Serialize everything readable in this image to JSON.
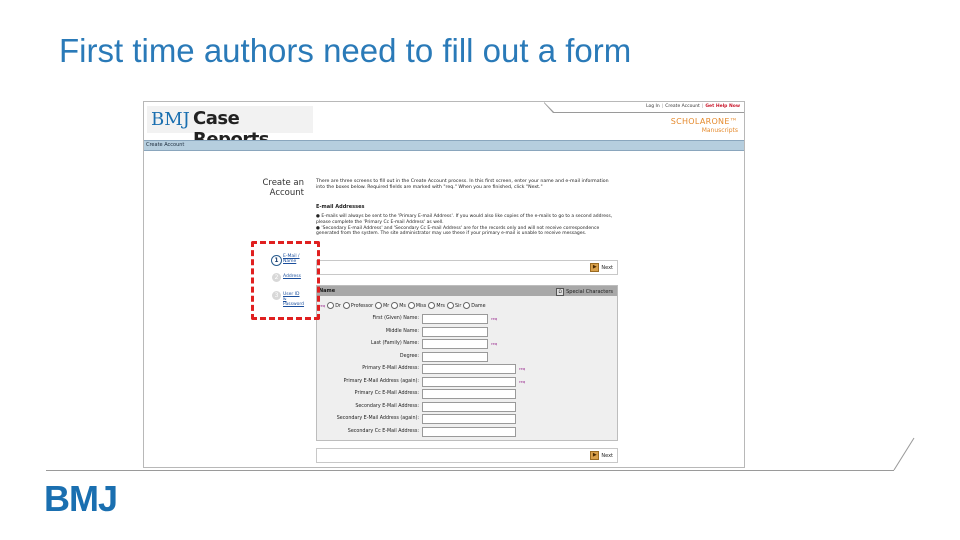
{
  "slide": {
    "title": "First time authors need to fill out a form",
    "logo": "BMJ"
  },
  "screenshot": {
    "top_links": {
      "login": "Log In",
      "create": "Create Account",
      "help": "Get Help Now"
    },
    "brand": {
      "bmj": "BMJ",
      "name": "Case Reports"
    },
    "scholarone": {
      "line1": "SCHOLARONE™",
      "line2": "Manuscripts"
    },
    "nav_label": "Create Account",
    "page_title_line1": "Create an",
    "page_title_line2": "Account",
    "intro": "There are three screens to fill out in the Create Account process. In this first screen, enter your name and e-mail information into the boxes below. Required fields are marked with \"req.\" When you are finished, click \"Next.\"",
    "email_heading": "E-mail Addresses",
    "bullet1": "E-mails will always be sent to the 'Primary E-mail Address'. If you would also like copies of the e-mails to go to a second address, please complete the 'Primary Cc E-mail Address' as well.",
    "bullet2": "'Secondary E-mail Address' and 'Secondary Cc E-mail Address' are for the records only and will not receive correspondence generated from the system. The site administrator may use these if your primary e-mail is unable to receive messages.",
    "steps": [
      {
        "num": "1",
        "label_a": "E-Mail /",
        "label_b": "Name",
        "label_c": ""
      },
      {
        "num": "2",
        "label_a": "Address",
        "label_b": "",
        "label_c": ""
      },
      {
        "num": "3",
        "label_a": "User ID",
        "label_b": "&",
        "label_c": "Password"
      }
    ],
    "next_label": "Next",
    "form": {
      "section": "Name",
      "special_chars": "Special Characters",
      "req": "req",
      "titles": [
        "Dr",
        "Professor",
        "Mr",
        "Ms",
        "Miss",
        "Mrs",
        "Sir",
        "Dame"
      ],
      "fields": [
        {
          "label": "First (Given) Name:",
          "req": "req"
        },
        {
          "label": "Middle Name:",
          "req": ""
        },
        {
          "label": "Last (Family) Name:",
          "req": "req"
        },
        {
          "label": "Degree:",
          "req": ""
        },
        {
          "label": "Primary E-Mail Address:",
          "req": "req"
        },
        {
          "label": "Primary E-Mail Address (again):",
          "req": "req"
        },
        {
          "label": "Primary Cc E-Mail Address:",
          "req": ""
        },
        {
          "label": "Secondary E-Mail Address:",
          "req": ""
        },
        {
          "label": "Secondary E-Mail Address (again):",
          "req": ""
        },
        {
          "label": "Secondary Cc E-Mail Address:",
          "req": ""
        }
      ]
    }
  },
  "colors": {
    "title_blue": "#2a7ab8",
    "callout_red": "#e02020",
    "nav_bar": "#b6cede",
    "orange": "#e58a2d"
  }
}
